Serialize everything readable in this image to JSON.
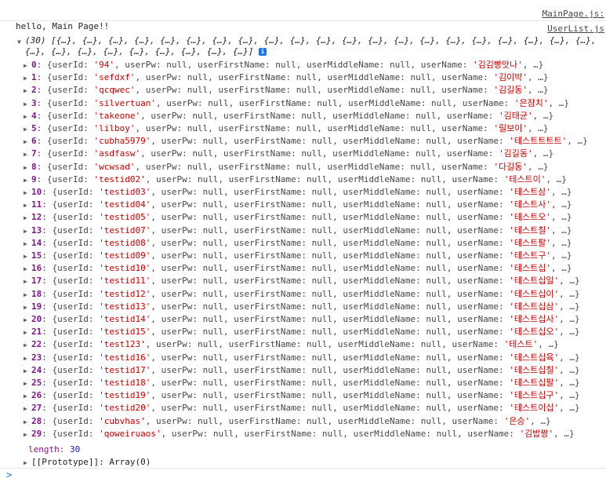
{
  "log1": {
    "message": "hello, Main Page!!",
    "source": "MainPage.js:"
  },
  "log2": {
    "source": "UserList.js",
    "summary": "(30) [{…}, {…}, {…}, {…}, {…}, {…}, {…}, {…}, {…}, {…}, {…}, {…}, {…}, {…}, {…}, {…}, {…}, {…}, {…}, {…}, {…}, {…}, {…}, {…}, {…}, {…}, {…}, {…}, {…}, {…}]",
    "info_badge": "i",
    "items": [
      {
        "index": "0",
        "userId": "'94'",
        "userName": "'김김빵맛나'"
      },
      {
        "index": "1",
        "userId": "'sefdxf'",
        "userName": "'김이박'"
      },
      {
        "index": "2",
        "userId": "'qcqwec'",
        "userName": "'김길동'"
      },
      {
        "index": "3",
        "userId": "'silvertuan'",
        "userName": "'은잠치'"
      },
      {
        "index": "4",
        "userId": "'takeone'",
        "userName": "'김태균'"
      },
      {
        "index": "5",
        "userId": "'lilboy'",
        "userName": "'릴보이'"
      },
      {
        "index": "6",
        "userId": "'cubha5979'",
        "userName": "'테스트트트트'"
      },
      {
        "index": "7",
        "userId": "'asdfasw'",
        "userName": "'김길동'"
      },
      {
        "index": "8",
        "userId": "'wcwsad'",
        "userName": "'다길동'"
      },
      {
        "index": "9",
        "userId": "'testid02'",
        "userName": "'테스트이'"
      },
      {
        "index": "10",
        "userId": "'testid03'",
        "userName": "'테스트삼'"
      },
      {
        "index": "11",
        "userId": "'testid04'",
        "userName": "'테스트사'"
      },
      {
        "index": "12",
        "userId": "'testid05'",
        "userName": "'테스트오'"
      },
      {
        "index": "13",
        "userId": "'testid07'",
        "userName": "'테스트칠'"
      },
      {
        "index": "14",
        "userId": "'testid08'",
        "userName": "'테스트팔'"
      },
      {
        "index": "15",
        "userId": "'testid09'",
        "userName": "'테스트구'"
      },
      {
        "index": "16",
        "userId": "'testid10'",
        "userName": "'테스트십'"
      },
      {
        "index": "17",
        "userId": "'testid11'",
        "userName": "'테스트십일'"
      },
      {
        "index": "18",
        "userId": "'testid12'",
        "userName": "'테스트십이'"
      },
      {
        "index": "19",
        "userId": "'testid13'",
        "userName": "'테스트십삼'"
      },
      {
        "index": "20",
        "userId": "'testid14'",
        "userName": "'테스트십사'"
      },
      {
        "index": "21",
        "userId": "'testid15'",
        "userName": "'테스트십오'"
      },
      {
        "index": "22",
        "userId": "'test123'",
        "userName": "'테스트'"
      },
      {
        "index": "23",
        "userId": "'testid16'",
        "userName": "'테스트십육'"
      },
      {
        "index": "24",
        "userId": "'testid17'",
        "userName": "'테스트십칠'"
      },
      {
        "index": "25",
        "userId": "'testid18'",
        "userName": "'테스트십팔'"
      },
      {
        "index": "26",
        "userId": "'testid19'",
        "userName": "'테스트십구'"
      },
      {
        "index": "27",
        "userId": "'testid20'",
        "userName": "'테스트이십'"
      },
      {
        "index": "28",
        "userId": "'cubvhas'",
        "userName": "'은승'"
      },
      {
        "index": "29",
        "userId": "'qoweiruaos'",
        "userName": "'김밥짱'"
      }
    ],
    "length_label": "length",
    "length_value": "30",
    "prototype_label": "[[Prototype]]: Array(0)"
  },
  "prompt_symbol": ">",
  "colors": {
    "key": "#881391",
    "string": "#c80000",
    "number": "#1a1aa6",
    "link": "#1a73e8"
  }
}
